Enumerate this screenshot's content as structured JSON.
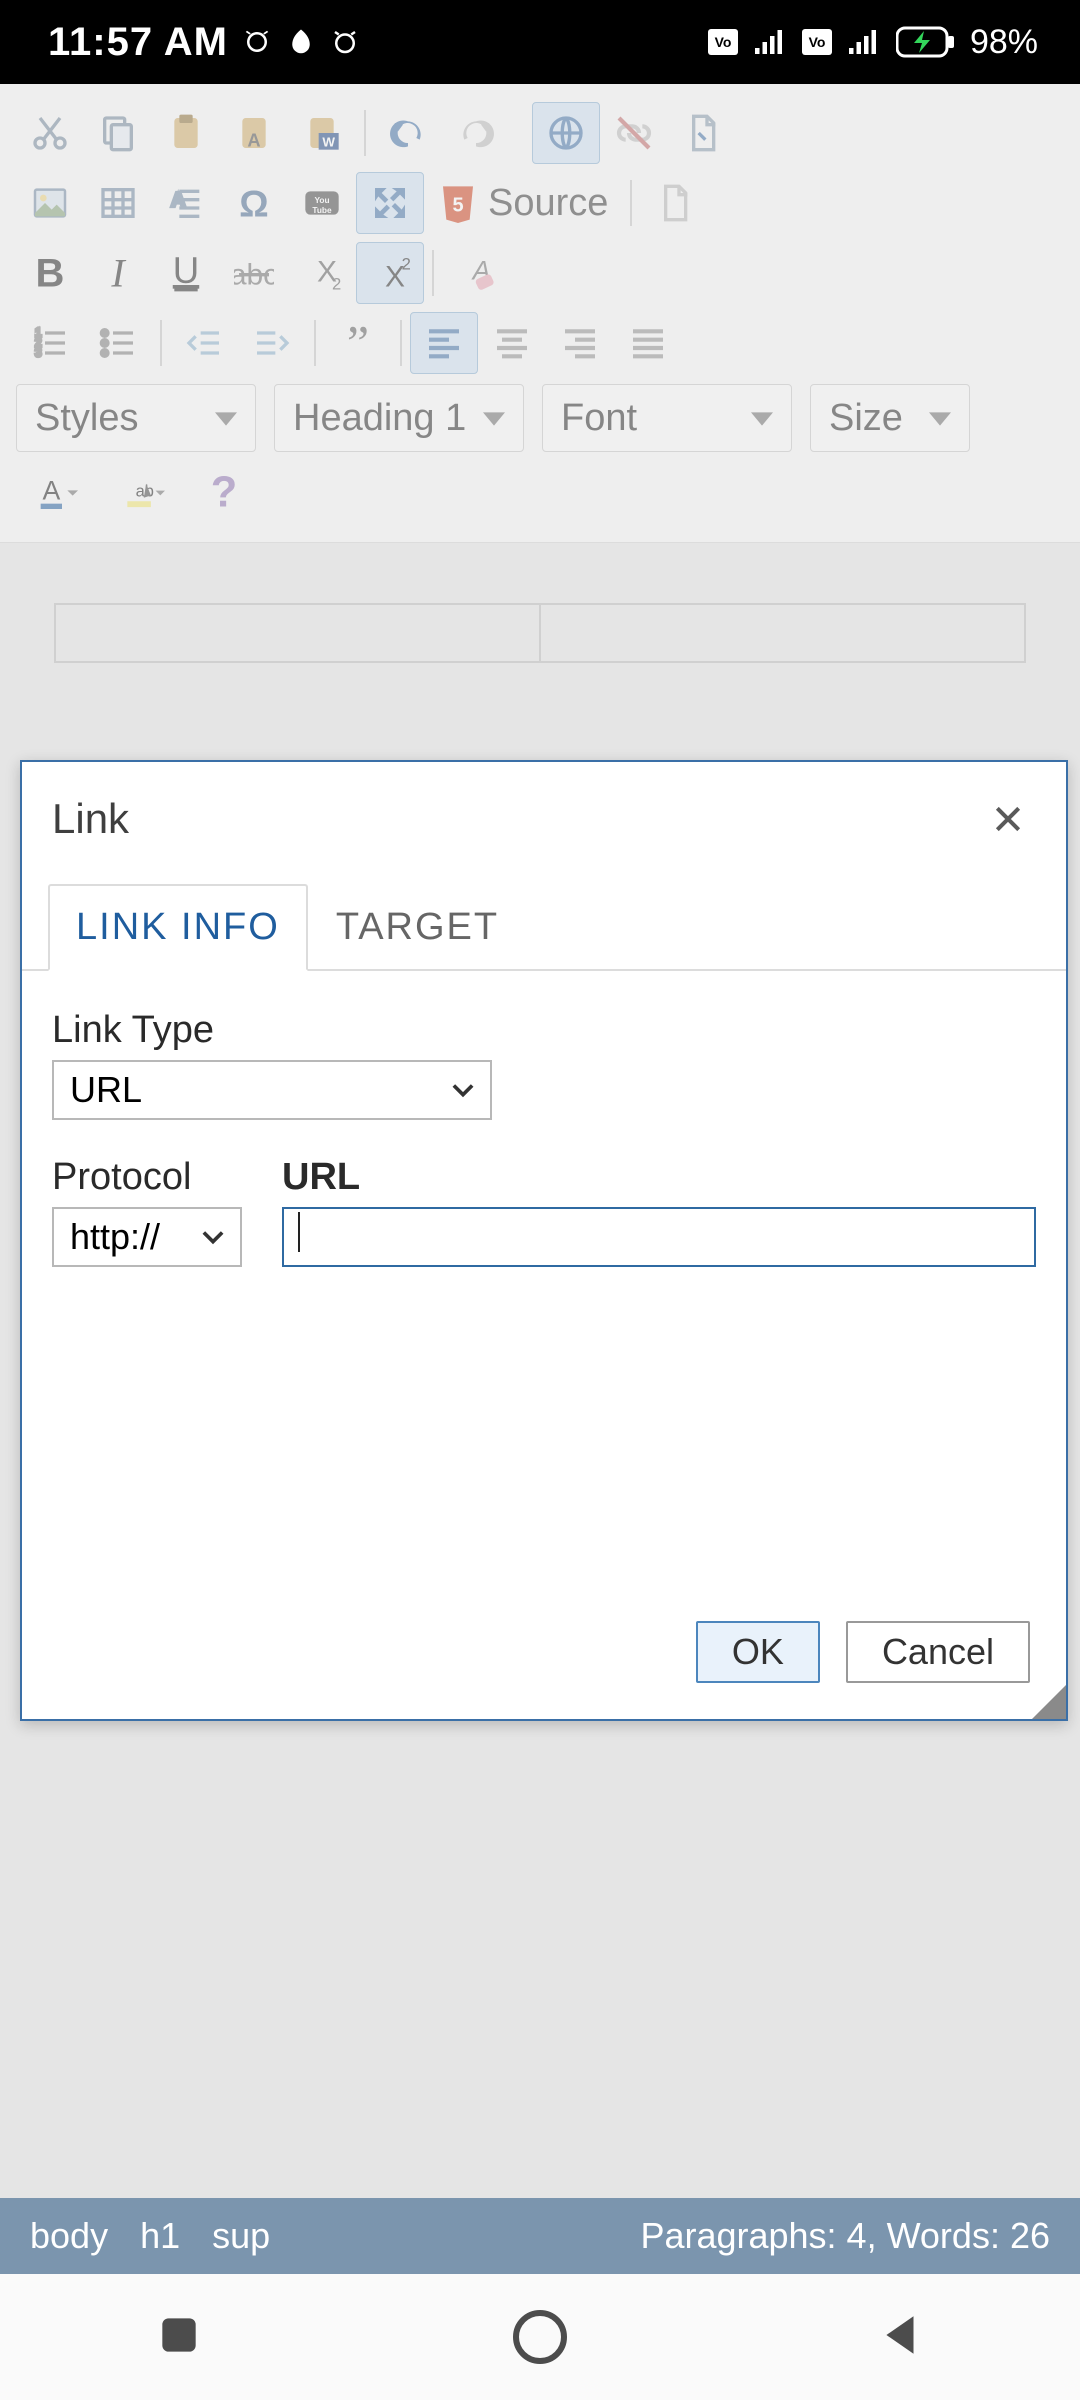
{
  "statusbar": {
    "time": "11:57 AM",
    "battery_percent": "98%"
  },
  "toolbar": {
    "source_label": "Source",
    "dropdowns": {
      "styles": "Styles",
      "paragraph": "Heading 1",
      "font": "Font",
      "size": "Size"
    }
  },
  "dialog": {
    "title": "Link",
    "tabs": {
      "link_info": "LINK INFO",
      "target": "TARGET"
    },
    "fields": {
      "link_type_label": "Link Type",
      "link_type_value": "URL",
      "protocol_label": "Protocol",
      "protocol_value": "http://",
      "url_label": "URL",
      "url_value": ""
    },
    "buttons": {
      "ok": "OK",
      "cancel": "Cancel"
    }
  },
  "footer": {
    "path": [
      "body",
      "h1",
      "sup"
    ],
    "stats": "Paragraphs: 4, Words: 26"
  }
}
